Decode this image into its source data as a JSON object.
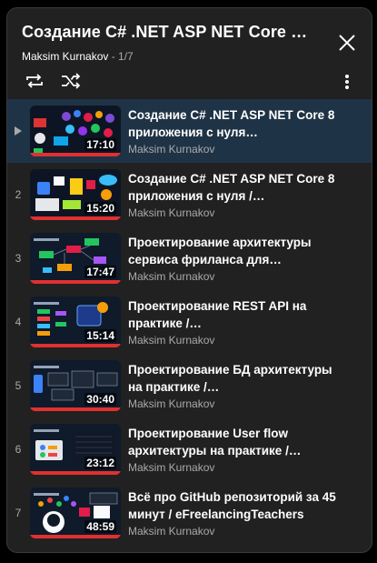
{
  "playlist": {
    "title": "Создание C# .NET ASP NET Core 8 ...",
    "owner": "Maksim Kurnakov",
    "separator": " - ",
    "position": "1/7"
  },
  "icons": {
    "close": "close-icon",
    "loop": "loop-icon",
    "shuffle": "shuffle-icon",
    "more": "more-vert-icon",
    "playing": "play-indicator-icon"
  },
  "colors": {
    "active_row": "#1f3346",
    "progress": "#e03030",
    "panel": "#212121"
  },
  "videos": [
    {
      "index": "▶",
      "title": "Создание C# .NET ASP NET Core 8 приложения с нуля…",
      "channel": "Maksim Kurnakov",
      "duration": "17:10",
      "watched": 1.0
    },
    {
      "index": "2",
      "title": "Создание C# .NET ASP NET Core 8 приложения с нуля /…",
      "channel": "Maksim Kurnakov",
      "duration": "15:20",
      "watched": 1.0
    },
    {
      "index": "3",
      "title": "Проектирование архитектуры сервиса фриланса для…",
      "channel": "Maksim Kurnakov",
      "duration": "17:47",
      "watched": 1.0
    },
    {
      "index": "4",
      "title": "Проектирование REST API на практике /…",
      "channel": "Maksim Kurnakov",
      "duration": "15:14",
      "watched": 1.0
    },
    {
      "index": "5",
      "title": "Проектирование БД архитектуры на практике /…",
      "channel": "Maksim Kurnakov",
      "duration": "30:40",
      "watched": 1.0
    },
    {
      "index": "6",
      "title": "Проектирование User flow архитектуры на практике /…",
      "channel": "Maksim Kurnakov",
      "duration": "23:12",
      "watched": 1.0
    },
    {
      "index": "7",
      "title": "Всё про GitHub репозиторий за 45 минут / eFreelancingTeachers",
      "channel": "Maksim Kurnakov",
      "duration": "48:59",
      "watched": 1.0
    }
  ]
}
